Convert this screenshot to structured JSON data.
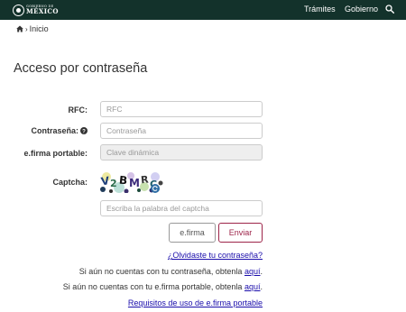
{
  "header": {
    "logo_small": "GOBIERNO DE",
    "logo_big": "MÉXICO",
    "nav": [
      "Trámites",
      "Gobierno"
    ],
    "search_icon": "search-icon",
    "background": "#13322b"
  },
  "breadcrumb": {
    "home_icon": "home-icon",
    "separator": "›",
    "label": "Inicio"
  },
  "page_title": "Acceso por contraseña",
  "form": {
    "rfc_label": "RFC:",
    "rfc_placeholder": "RFC",
    "password_label": "Contraseña:",
    "password_placeholder": "Contraseña",
    "efirma_label": "e.firma portable:",
    "efirma_placeholder": "Clave dinámica",
    "captcha_label": "Captcha:",
    "captcha_placeholder": "Escriba la palabra del captcha",
    "captcha_image_text": "V2BMRC",
    "efirma_button": "e.firma",
    "submit_button": "Enviar",
    "accent": "#9d2449"
  },
  "links": {
    "forgot": "¿Olvidaste tu contraseña?",
    "no_password_text": "Si aún no cuentas con tu contraseña, obtenla",
    "no_password_link": "aquí",
    "no_efirma_text": "Si aún no cuentas con tu e.firma portable, obtenla",
    "no_efirma_link": "aquí",
    "requirements": "Requisitos de uso de e.firma portable",
    "period": "."
  }
}
